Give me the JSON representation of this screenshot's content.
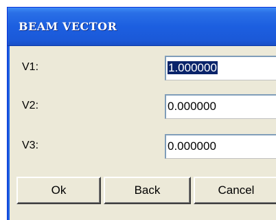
{
  "window": {
    "title": "BEAM VECTOR"
  },
  "fields": [
    {
      "label": "V1:",
      "value": "1.000000",
      "selected": true
    },
    {
      "label": "V2:",
      "value": "0.000000",
      "selected": false
    },
    {
      "label": "V3:",
      "value": "0.000000",
      "selected": false
    }
  ],
  "buttons": {
    "ok_label": "Ok",
    "back_label": "Back",
    "cancel_label": "Cancel"
  },
  "colors": {
    "titlebar": "#1c5fe0",
    "dialog_background": "#ece9d8",
    "selection": "#0a246a"
  }
}
